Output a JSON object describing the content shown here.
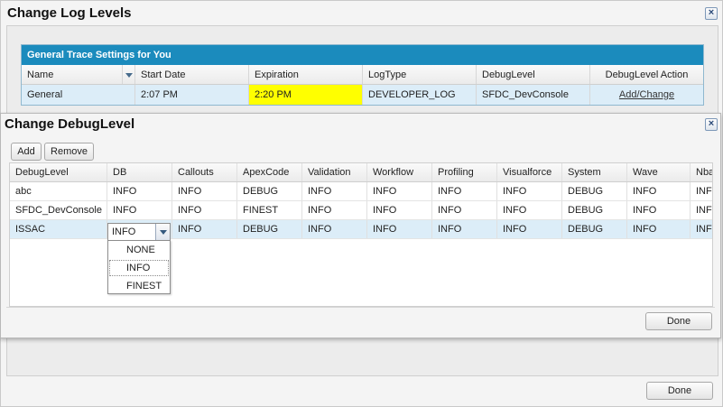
{
  "outer_dialog": {
    "title": "Change Log Levels",
    "close_symbol": "×",
    "done_label": "Done"
  },
  "trace_settings": {
    "header": "General Trace Settings for You",
    "columns": [
      "Name",
      "Start Date",
      "Expiration",
      "LogType",
      "DebugLevel",
      "DebugLevel Action"
    ],
    "row": {
      "name": "General",
      "start_date": "2:07 PM",
      "expiration": "2:20 PM",
      "log_type": "DEVELOPER_LOG",
      "debug_level": "SFDC_DevConsole",
      "action": "Add/Change"
    },
    "highlight_color": "#ffff00"
  },
  "inner_dialog": {
    "title": "Change DebugLevel",
    "close_symbol": "×",
    "add_label": "Add",
    "remove_label": "Remove",
    "done_label": "Done",
    "columns": [
      "DebugLevel",
      "DB",
      "Callouts",
      "ApexCode",
      "Validation",
      "Workflow",
      "Profiling",
      "Visualforce",
      "System",
      "Wave",
      "Nba"
    ],
    "rows": [
      [
        "abc",
        "INFO",
        "INFO",
        "DEBUG",
        "INFO",
        "INFO",
        "INFO",
        "INFO",
        "DEBUG",
        "INFO",
        "INF"
      ],
      [
        "SFDC_DevConsole",
        "INFO",
        "INFO",
        "FINEST",
        "INFO",
        "INFO",
        "INFO",
        "INFO",
        "DEBUG",
        "INFO",
        "INF"
      ],
      [
        "ISSAC",
        "INFO",
        "INFO",
        "DEBUG",
        "INFO",
        "INFO",
        "INFO",
        "INFO",
        "DEBUG",
        "INFO",
        "INF"
      ]
    ],
    "editing_cell_value": "INFO",
    "dropdown_options": [
      "NONE",
      "INFO",
      "FINEST"
    ],
    "selected_row_color": "#dcedf8"
  },
  "colors": {
    "accent": "#1b8bbd"
  }
}
